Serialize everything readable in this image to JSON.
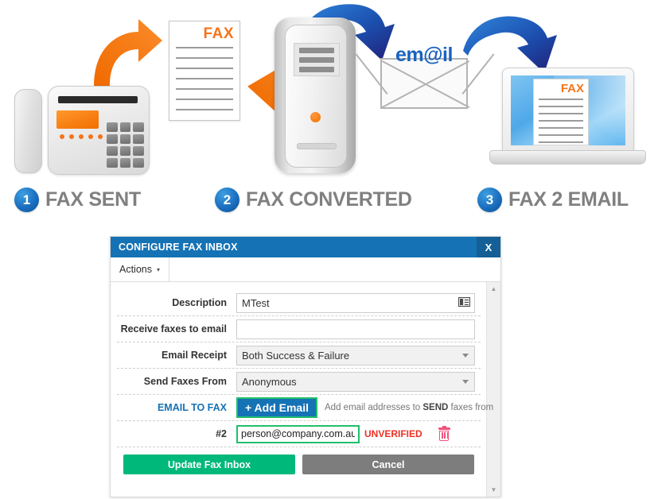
{
  "illustration": {
    "fax_word": "FAX",
    "email_word": "em@il",
    "laptop_fax_word": "FAX",
    "steps": [
      {
        "num": "1",
        "label": "FAX SENT"
      },
      {
        "num": "2",
        "label": "FAX CONVERTED"
      },
      {
        "num": "3",
        "label": "FAX 2 EMAIL"
      }
    ],
    "colors": {
      "orange": "#f4741b",
      "blue_light": "#1f7ccc",
      "blue_dark": "#20227a",
      "step_blue": "#1b6fc0",
      "step_text": "#808080"
    }
  },
  "dialog": {
    "title": "CONFIGURE FAX INBOX",
    "close_label": "X",
    "toolbar": {
      "actions_label": "Actions",
      "actions_caret": "▾"
    },
    "fields": {
      "description": {
        "label": "Description",
        "value": "MTest",
        "placeholder": ""
      },
      "receive_faxes_to_email": {
        "label": "Receive faxes to email",
        "value": "",
        "placeholder": ""
      },
      "email_receipt": {
        "label": "Email Receipt",
        "value": "Both Success & Failure"
      },
      "send_faxes_from": {
        "label": "Send Faxes From",
        "value": "Anonymous"
      },
      "email_to_fax": {
        "label": "EMAIL TO FAX",
        "add_button": "+ Add Email",
        "hint_pre": "Add email addresses to ",
        "hint_strong": "SEND",
        "hint_post": " faxes from"
      },
      "email_row": {
        "index_label": "#2",
        "value": "person@company.com.au",
        "status": "UNVERIFIED"
      }
    },
    "buttons": {
      "update": "Update Fax Inbox",
      "cancel": "Cancel"
    },
    "scrollbar": {
      "up": "▲",
      "down": "▼"
    },
    "colors": {
      "title_bar": "#1572b5",
      "close_bg": "#135f96",
      "highlight_green": "#20bf6b",
      "status_red": "#ee3124",
      "update_green": "#00b87a",
      "cancel_gray": "#7d7d7d",
      "trash_pink": "#f2527b"
    }
  }
}
